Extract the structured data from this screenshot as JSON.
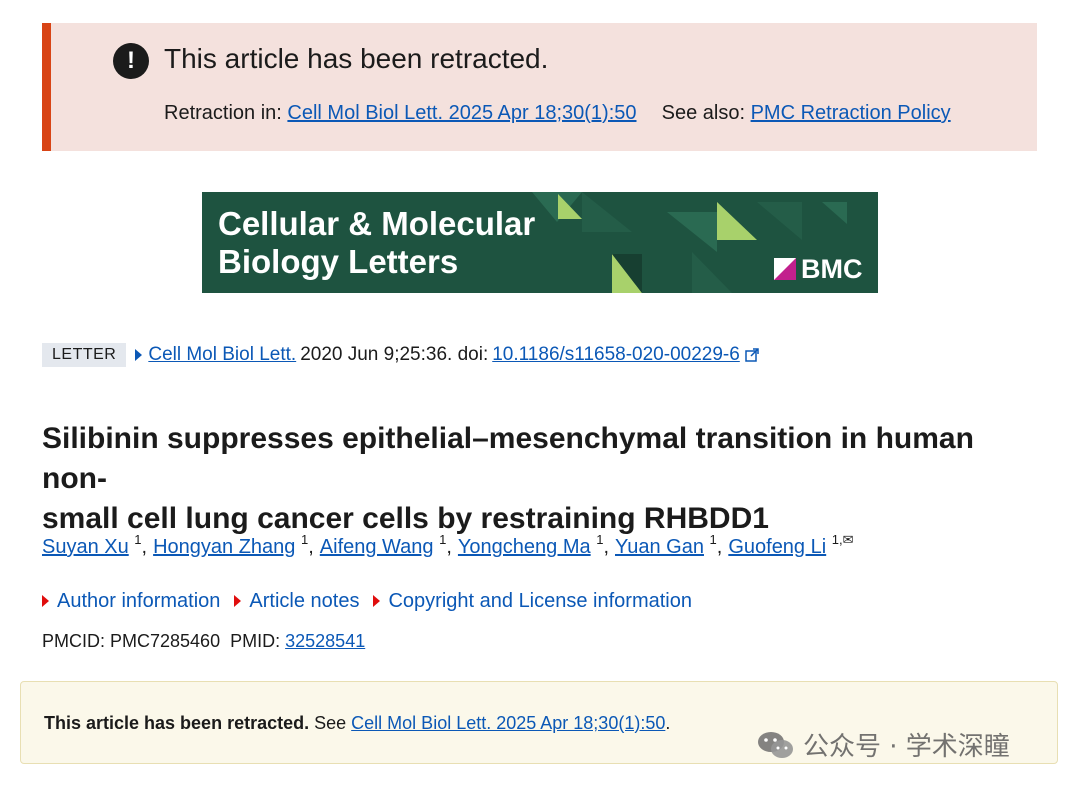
{
  "retraction_banner": {
    "icon": "exclamation-icon",
    "title": "This article has been retracted.",
    "retraction_in_label": "Retraction in:",
    "retraction_in_link": "Cell Mol Biol Lett. 2025 Apr 18;30(1):50",
    "see_also_label": "See also:",
    "see_also_link": "PMC Retraction Policy",
    "accent_color": "#d84415",
    "background_color": "#f4e1dd"
  },
  "journal_banner": {
    "title_line1": "Cellular & Molecular",
    "title_line2": "Biology Letters",
    "publisher": "BMC",
    "background_color": "#1e5340",
    "accent_color": "#a8d16b"
  },
  "citation": {
    "type_badge": "LETTER",
    "journal_link": "Cell Mol Biol Lett.",
    "date_volume": "2020 Jun 9;25:36. doi:",
    "doi_link": "10.1186/s11658-020-00229-6"
  },
  "article": {
    "title_line1": "Silibinin suppresses epithelial–mesenchymal transition in human non-",
    "title_line2": "small cell lung cancer cells by restraining RHBDD1"
  },
  "authors": [
    {
      "name": "Suyan Xu",
      "affil": "1"
    },
    {
      "name": "Hongyan Zhang",
      "affil": "1"
    },
    {
      "name": "Aifeng Wang",
      "affil": "1"
    },
    {
      "name": "Yongcheng Ma",
      "affil": "1"
    },
    {
      "name": "Yuan Gan",
      "affil": "1"
    },
    {
      "name": "Guofeng Li",
      "affil": "1,✉"
    }
  ],
  "toggles": {
    "author_info": "Author information",
    "article_notes": "Article notes",
    "copyright": "Copyright and License information"
  },
  "ids": {
    "pmcid_label": "PMCID: PMC7285460",
    "pmid_label": "PMID:",
    "pmid_link": "32528541"
  },
  "notice": {
    "bold_text": "This article has been retracted.",
    "see_text": "See",
    "link": "Cell Mol Biol Lett. 2025 Apr 18;30(1):50",
    "trailing": "."
  },
  "watermark": {
    "text": "公众号 · 学术深瞳",
    "icon": "wechat-icon"
  }
}
